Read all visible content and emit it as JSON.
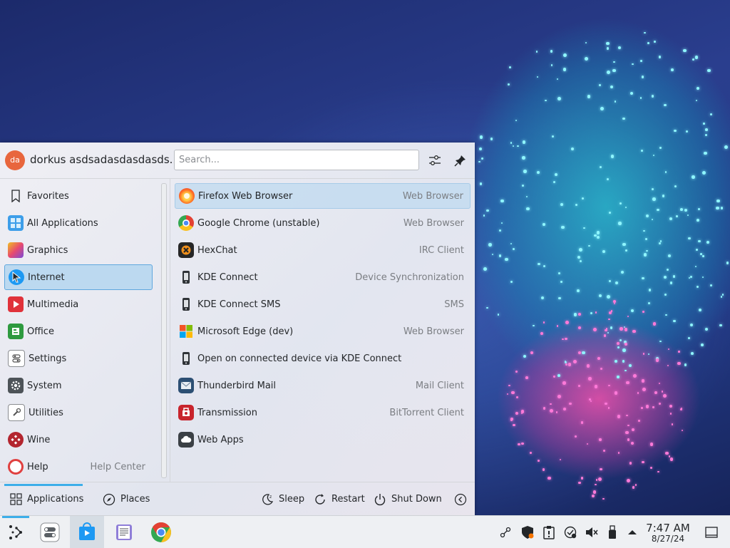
{
  "user": {
    "initials": "da",
    "name": "dorkus asdsadasdasdasds..."
  },
  "search": {
    "placeholder": "Search..."
  },
  "categories": [
    {
      "label": "Favorites",
      "icon": "bookmark-icon"
    },
    {
      "label": "All Applications",
      "icon": "grid-icon"
    },
    {
      "label": "Graphics",
      "icon": "graphics-icon"
    },
    {
      "label": "Internet",
      "icon": "globe-icon",
      "selected": true
    },
    {
      "label": "Multimedia",
      "icon": "play-icon"
    },
    {
      "label": "Office",
      "icon": "office-icon"
    },
    {
      "label": "Settings",
      "icon": "settings-icon"
    },
    {
      "label": "System",
      "icon": "gear-icon"
    },
    {
      "label": "Utilities",
      "icon": "utilities-icon"
    },
    {
      "label": "Wine",
      "icon": "wine-icon"
    },
    {
      "label": "Help",
      "sub": "Help Center",
      "icon": "help-icon"
    }
  ],
  "apps": [
    {
      "name": "Firefox Web Browser",
      "desc": "Web Browser",
      "icon": "firefox-icon",
      "selected": true
    },
    {
      "name": "Google Chrome (unstable)",
      "desc": "Web Browser",
      "icon": "chrome-icon"
    },
    {
      "name": "HexChat",
      "desc": "IRC Client",
      "icon": "hexchat-icon"
    },
    {
      "name": "KDE Connect",
      "desc": "Device Synchronization",
      "icon": "phone-icon"
    },
    {
      "name": "KDE Connect SMS",
      "desc": "SMS",
      "icon": "phone-icon"
    },
    {
      "name": "Microsoft Edge (dev)",
      "desc": "Web Browser",
      "icon": "edge-icon"
    },
    {
      "name": "Open on connected device via KDE Connect",
      "desc": "",
      "icon": "phone-icon"
    },
    {
      "name": "Thunderbird Mail",
      "desc": "Mail Client",
      "icon": "mail-icon"
    },
    {
      "name": "Transmission",
      "desc": "BitTorrent Client",
      "icon": "transmission-icon"
    },
    {
      "name": "Web Apps",
      "desc": "",
      "icon": "cloud-icon"
    }
  ],
  "footer": {
    "applications": "Applications",
    "places": "Places",
    "sleep": "Sleep",
    "restart": "Restart",
    "shutdown": "Shut Down"
  },
  "clock": {
    "time": "7:47 AM",
    "date": "8/27/24"
  },
  "colors": {
    "accent": "#3daee9",
    "selection": "#bcd9f0"
  }
}
